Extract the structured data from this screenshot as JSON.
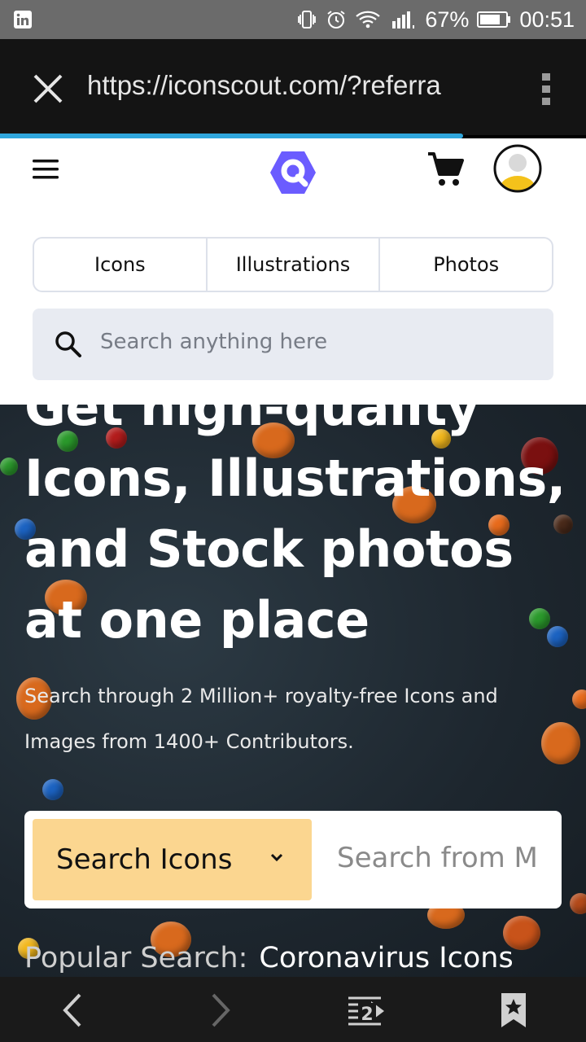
{
  "status_bar": {
    "notification_icon": "linkedin-icon",
    "battery_percent": "67%",
    "time": "00:51",
    "icons": [
      "vibrate-icon",
      "alarm-icon",
      "wifi-icon",
      "signal-icon",
      "battery-icon"
    ]
  },
  "browser": {
    "url": "https://iconscout.com/?referra",
    "close_icon": "close-icon",
    "menu_icon": "more-vert-icon",
    "progress": 0.79
  },
  "site_header": {
    "menu_icon": "hamburger-icon",
    "logo_icon": "iconscout-logo",
    "cart_icon": "cart-icon",
    "avatar_icon": "user-avatar-icon",
    "tabs": [
      {
        "label": "Icons"
      },
      {
        "label": "Illustrations"
      },
      {
        "label": "Photos"
      }
    ],
    "search_placeholder": "Search anything here"
  },
  "hero": {
    "title_lines": [
      "Get high-quality",
      "Icons, Illustrations,",
      "and Stock photos",
      "at one place"
    ],
    "subtitle_line1": "Search through 2 Million+ royalty-free Icons and",
    "subtitle_line2": "Images from 1400+ Contributors.",
    "search_type": "Search Icons",
    "search_placeholder": "Search from M",
    "popular_label": "Popular Search:",
    "popular_tag": "Coronavirus Icons"
  },
  "bottom_nav": {
    "back_icon": "back-icon",
    "forward_icon": "forward-icon",
    "tabs_count": "2",
    "bookmark_icon": "bookmark-icon"
  },
  "colors": {
    "accent_blue": "#2fa6dc",
    "logo_purple": "#6b5cff",
    "search_type_bg": "#fbd690",
    "hero_bg": "#1f2a33"
  }
}
